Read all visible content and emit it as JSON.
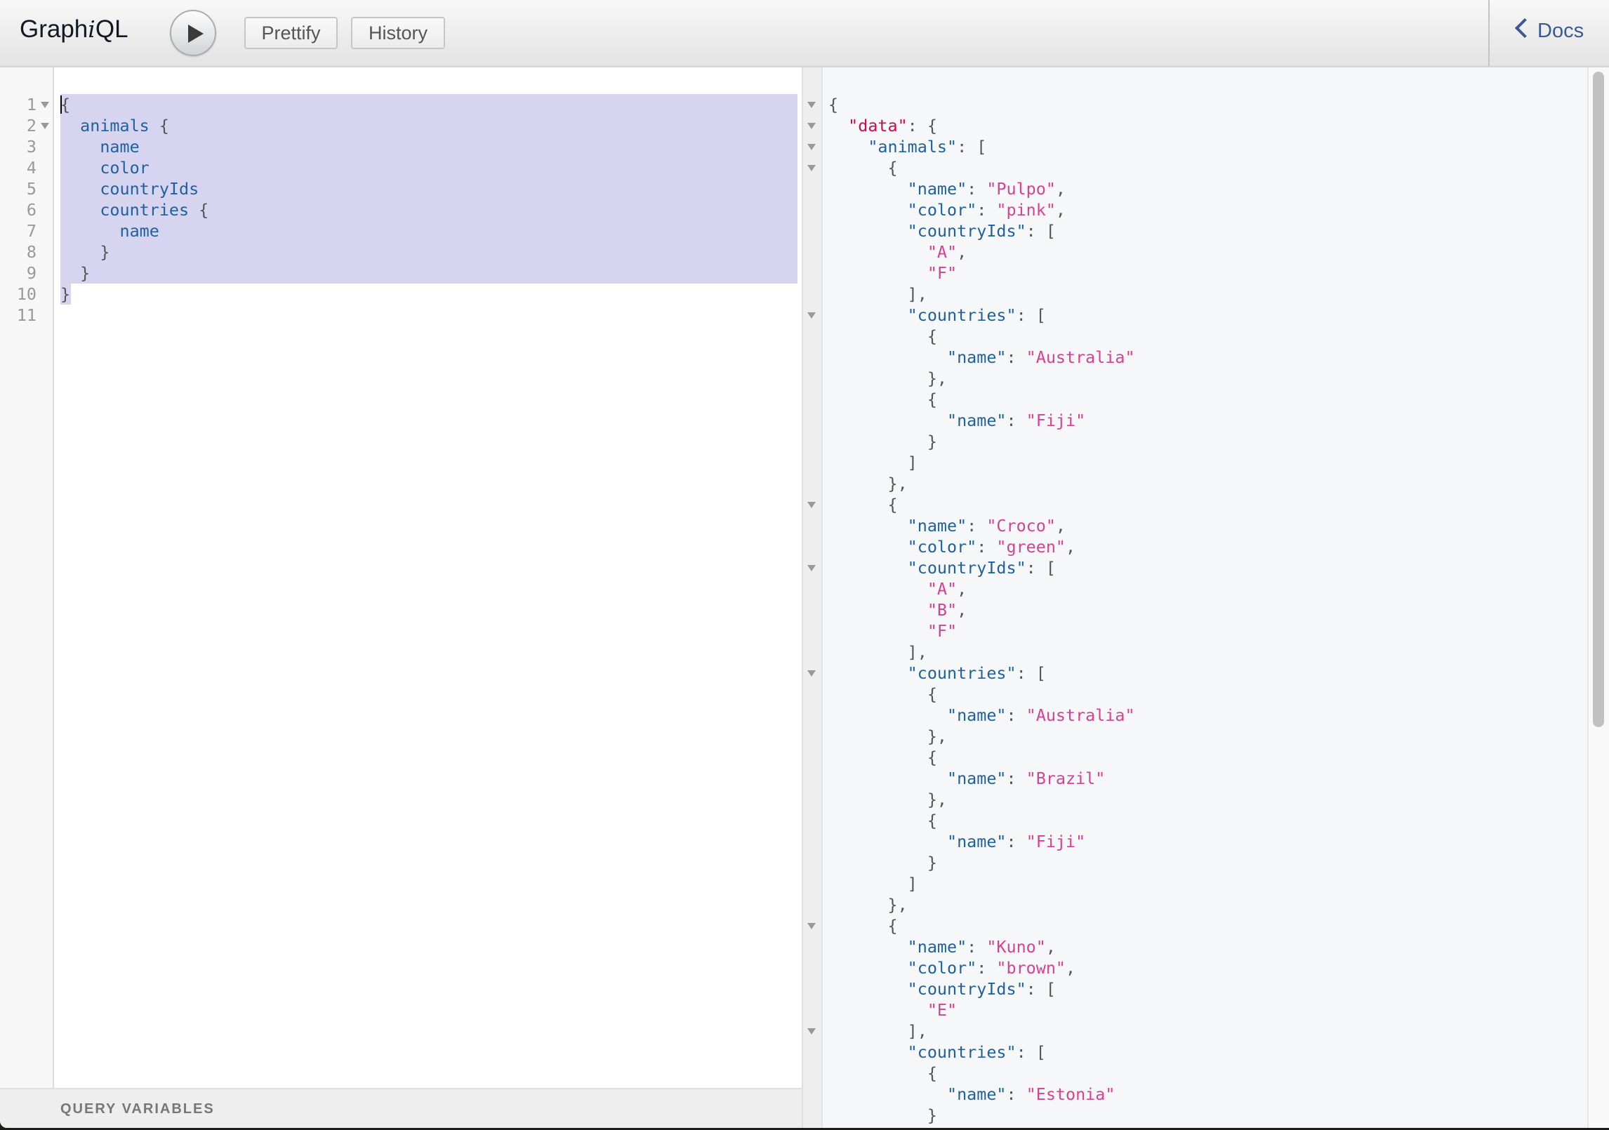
{
  "header": {
    "title_prefix": "Graph",
    "title_italic": "i",
    "title_suffix": "QL",
    "execute_label": "Execute Query",
    "prettify_label": "Prettify",
    "history_label": "History",
    "docs_label": "Docs"
  },
  "query_editor": {
    "line_numbers": [
      "1",
      "2",
      "3",
      "4",
      "5",
      "6",
      "7",
      "8",
      "9",
      "10",
      "11"
    ],
    "fold_lines": [
      1,
      2
    ],
    "lines": [
      [
        {
          "t": "{",
          "c": "p"
        }
      ],
      [
        {
          "t": "  ",
          "c": "p"
        },
        {
          "t": "animals",
          "c": "kw"
        },
        {
          "t": " {",
          "c": "p"
        }
      ],
      [
        {
          "t": "    ",
          "c": "p"
        },
        {
          "t": "name",
          "c": "kw"
        }
      ],
      [
        {
          "t": "    ",
          "c": "p"
        },
        {
          "t": "color",
          "c": "kw"
        }
      ],
      [
        {
          "t": "    ",
          "c": "p"
        },
        {
          "t": "countryIds",
          "c": "kw"
        }
      ],
      [
        {
          "t": "    ",
          "c": "p"
        },
        {
          "t": "countries",
          "c": "kw"
        },
        {
          "t": " {",
          "c": "p"
        }
      ],
      [
        {
          "t": "      ",
          "c": "p"
        },
        {
          "t": "name",
          "c": "kw"
        }
      ],
      [
        {
          "t": "    }",
          "c": "p"
        }
      ],
      [
        {
          "t": "  }",
          "c": "p"
        }
      ],
      [
        {
          "t": "}",
          "c": "p"
        }
      ],
      []
    ],
    "selection": "lines 1-10"
  },
  "query_variables": {
    "label": "QUERY VARIABLES"
  },
  "result": {
    "fold_lines": [
      1,
      2,
      3,
      4,
      11,
      20,
      23,
      28,
      40,
      45
    ],
    "lines": [
      [
        {
          "t": "{",
          "c": "p"
        }
      ],
      [
        {
          "t": "  ",
          "c": "p"
        },
        {
          "t": "\"data\"",
          "c": "rd"
        },
        {
          "t": ": {",
          "c": "p"
        }
      ],
      [
        {
          "t": "    ",
          "c": "p"
        },
        {
          "t": "\"animals\"",
          "c": "rk"
        },
        {
          "t": ": [",
          "c": "p"
        }
      ],
      [
        {
          "t": "      {",
          "c": "p"
        }
      ],
      [
        {
          "t": "        ",
          "c": "p"
        },
        {
          "t": "\"name\"",
          "c": "rk"
        },
        {
          "t": ": ",
          "c": "p"
        },
        {
          "t": "\"Pulpo\"",
          "c": "rs"
        },
        {
          "t": ",",
          "c": "p"
        }
      ],
      [
        {
          "t": "        ",
          "c": "p"
        },
        {
          "t": "\"color\"",
          "c": "rk"
        },
        {
          "t": ": ",
          "c": "p"
        },
        {
          "t": "\"pink\"",
          "c": "rs"
        },
        {
          "t": ",",
          "c": "p"
        }
      ],
      [
        {
          "t": "        ",
          "c": "p"
        },
        {
          "t": "\"countryIds\"",
          "c": "rk"
        },
        {
          "t": ": [",
          "c": "p"
        }
      ],
      [
        {
          "t": "          ",
          "c": "p"
        },
        {
          "t": "\"A\"",
          "c": "rs"
        },
        {
          "t": ",",
          "c": "p"
        }
      ],
      [
        {
          "t": "          ",
          "c": "p"
        },
        {
          "t": "\"F\"",
          "c": "rs"
        }
      ],
      [
        {
          "t": "        ],",
          "c": "p"
        }
      ],
      [
        {
          "t": "        ",
          "c": "p"
        },
        {
          "t": "\"countries\"",
          "c": "rk"
        },
        {
          "t": ": [",
          "c": "p"
        }
      ],
      [
        {
          "t": "          {",
          "c": "p"
        }
      ],
      [
        {
          "t": "            ",
          "c": "p"
        },
        {
          "t": "\"name\"",
          "c": "rk"
        },
        {
          "t": ": ",
          "c": "p"
        },
        {
          "t": "\"Australia\"",
          "c": "rs"
        }
      ],
      [
        {
          "t": "          },",
          "c": "p"
        }
      ],
      [
        {
          "t": "          {",
          "c": "p"
        }
      ],
      [
        {
          "t": "            ",
          "c": "p"
        },
        {
          "t": "\"name\"",
          "c": "rk"
        },
        {
          "t": ": ",
          "c": "p"
        },
        {
          "t": "\"Fiji\"",
          "c": "rs"
        }
      ],
      [
        {
          "t": "          }",
          "c": "p"
        }
      ],
      [
        {
          "t": "        ]",
          "c": "p"
        }
      ],
      [
        {
          "t": "      },",
          "c": "p"
        }
      ],
      [
        {
          "t": "      {",
          "c": "p"
        }
      ],
      [
        {
          "t": "        ",
          "c": "p"
        },
        {
          "t": "\"name\"",
          "c": "rk"
        },
        {
          "t": ": ",
          "c": "p"
        },
        {
          "t": "\"Croco\"",
          "c": "rs"
        },
        {
          "t": ",",
          "c": "p"
        }
      ],
      [
        {
          "t": "        ",
          "c": "p"
        },
        {
          "t": "\"color\"",
          "c": "rk"
        },
        {
          "t": ": ",
          "c": "p"
        },
        {
          "t": "\"green\"",
          "c": "rs"
        },
        {
          "t": ",",
          "c": "p"
        }
      ],
      [
        {
          "t": "        ",
          "c": "p"
        },
        {
          "t": "\"countryIds\"",
          "c": "rk"
        },
        {
          "t": ": [",
          "c": "p"
        }
      ],
      [
        {
          "t": "          ",
          "c": "p"
        },
        {
          "t": "\"A\"",
          "c": "rs"
        },
        {
          "t": ",",
          "c": "p"
        }
      ],
      [
        {
          "t": "          ",
          "c": "p"
        },
        {
          "t": "\"B\"",
          "c": "rs"
        },
        {
          "t": ",",
          "c": "p"
        }
      ],
      [
        {
          "t": "          ",
          "c": "p"
        },
        {
          "t": "\"F\"",
          "c": "rs"
        }
      ],
      [
        {
          "t": "        ],",
          "c": "p"
        }
      ],
      [
        {
          "t": "        ",
          "c": "p"
        },
        {
          "t": "\"countries\"",
          "c": "rk"
        },
        {
          "t": ": [",
          "c": "p"
        }
      ],
      [
        {
          "t": "          {",
          "c": "p"
        }
      ],
      [
        {
          "t": "            ",
          "c": "p"
        },
        {
          "t": "\"name\"",
          "c": "rk"
        },
        {
          "t": ": ",
          "c": "p"
        },
        {
          "t": "\"Australia\"",
          "c": "rs"
        }
      ],
      [
        {
          "t": "          },",
          "c": "p"
        }
      ],
      [
        {
          "t": "          {",
          "c": "p"
        }
      ],
      [
        {
          "t": "            ",
          "c": "p"
        },
        {
          "t": "\"name\"",
          "c": "rk"
        },
        {
          "t": ": ",
          "c": "p"
        },
        {
          "t": "\"Brazil\"",
          "c": "rs"
        }
      ],
      [
        {
          "t": "          },",
          "c": "p"
        }
      ],
      [
        {
          "t": "          {",
          "c": "p"
        }
      ],
      [
        {
          "t": "            ",
          "c": "p"
        },
        {
          "t": "\"name\"",
          "c": "rk"
        },
        {
          "t": ": ",
          "c": "p"
        },
        {
          "t": "\"Fiji\"",
          "c": "rs"
        }
      ],
      [
        {
          "t": "          }",
          "c": "p"
        }
      ],
      [
        {
          "t": "        ]",
          "c": "p"
        }
      ],
      [
        {
          "t": "      },",
          "c": "p"
        }
      ],
      [
        {
          "t": "      {",
          "c": "p"
        }
      ],
      [
        {
          "t": "        ",
          "c": "p"
        },
        {
          "t": "\"name\"",
          "c": "rk"
        },
        {
          "t": ": ",
          "c": "p"
        },
        {
          "t": "\"Kuno\"",
          "c": "rs"
        },
        {
          "t": ",",
          "c": "p"
        }
      ],
      [
        {
          "t": "        ",
          "c": "p"
        },
        {
          "t": "\"color\"",
          "c": "rk"
        },
        {
          "t": ": ",
          "c": "p"
        },
        {
          "t": "\"brown\"",
          "c": "rs"
        },
        {
          "t": ",",
          "c": "p"
        }
      ],
      [
        {
          "t": "        ",
          "c": "p"
        },
        {
          "t": "\"countryIds\"",
          "c": "rk"
        },
        {
          "t": ": [",
          "c": "p"
        }
      ],
      [
        {
          "t": "          ",
          "c": "p"
        },
        {
          "t": "\"E\"",
          "c": "rs"
        }
      ],
      [
        {
          "t": "        ],",
          "c": "p"
        }
      ],
      [
        {
          "t": "        ",
          "c": "p"
        },
        {
          "t": "\"countries\"",
          "c": "rk"
        },
        {
          "t": ": [",
          "c": "p"
        }
      ],
      [
        {
          "t": "          {",
          "c": "p"
        }
      ],
      [
        {
          "t": "            ",
          "c": "p"
        },
        {
          "t": "\"name\"",
          "c": "rk"
        },
        {
          "t": ": ",
          "c": "p"
        },
        {
          "t": "\"Estonia\"",
          "c": "rs"
        }
      ],
      [
        {
          "t": "          }",
          "c": "p"
        }
      ]
    ]
  },
  "colors": {
    "keyword": "#1f61a0",
    "string": "#d64292",
    "data_key": "#ca0c4e",
    "punctuation": "#555555",
    "selection": "#d7d4f0",
    "docs_link": "#3b5998"
  }
}
